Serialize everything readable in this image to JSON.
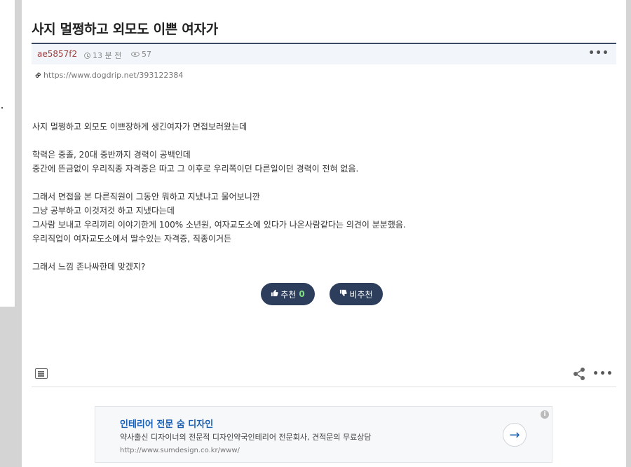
{
  "post": {
    "title": "사지 멀쩡하고 외모도 이쁜 여자가",
    "author": "ae5857f2",
    "time_ago": "13 분 전",
    "views": "57",
    "more_label": "•••",
    "link": "https://www.dogdrip.net/393122384",
    "body_lines": [
      "사지 멀쩡하고 외모도 이쁘장하게 생긴여자가 면접보러왔는데",
      "",
      "학력은 중졸, 20대 중반까지 경력이 공백인데",
      "중간에 뜬금없이 우리직종 자격증은 따고 그 이후로 우리쪽이던 다른일이던 경력이 전혀 없음.",
      "",
      "그래서 면접을 본 다른직원이 그동안 뭐하고 지냈냐고 물어보니깐",
      "그냥 공부하고 이것저것 하고 지냈다는데",
      "그사람 보내고 우리끼리 이야기한게 100% 소년원, 여자교도소에 있다가 나온사람같다는 의견이 분분했음.",
      "우리직업이 여자교도소에서 딸수있는 자격증, 직종이거든",
      "",
      "그래서 느낌 존나싸한데 맞겠지?"
    ]
  },
  "votes": {
    "up_label": "추천",
    "up_count": "0",
    "down_label": "비추천"
  },
  "footer": {
    "more_label": "•••"
  },
  "ad": {
    "title": "인테리어 전문 숨 디자인",
    "description": "약사출신 디자이너의 전문적 디자인약국인테리어 전문회사, 견적문의 무료상담",
    "url": "http://www.sumdesign.co.kr/www/",
    "info_label": "i",
    "arrow_label": "→"
  },
  "colors": {
    "accent": "#2c3e5c",
    "author": "#9b3b3b",
    "ad_title": "#1a5fb4",
    "vote_count": "#7ee07e"
  },
  "icons": [
    "clock-icon",
    "eye-icon",
    "link-icon",
    "thumbs-up-icon",
    "thumbs-down-icon",
    "list-icon",
    "share-icon",
    "more-icon",
    "info-icon",
    "arrow-right-icon"
  ]
}
